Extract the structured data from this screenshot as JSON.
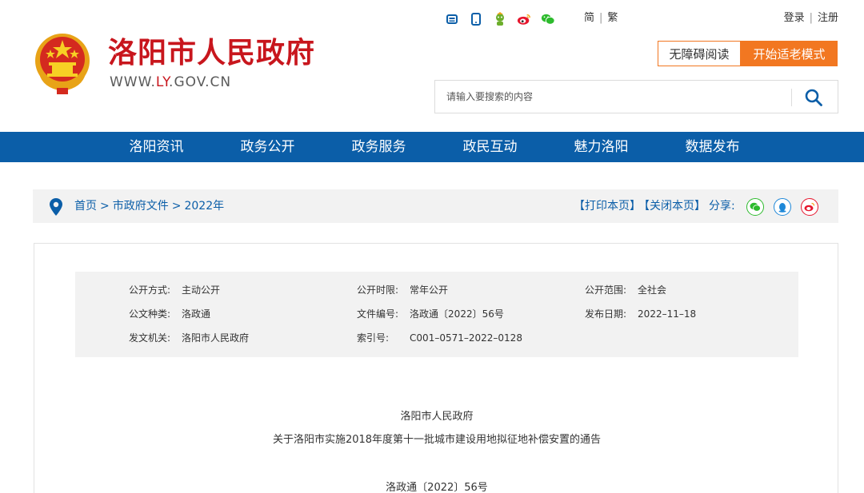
{
  "header": {
    "title": "洛阳市人民政府",
    "url_prefix": "WWW.",
    "url_highlight": "LY",
    "url_suffix": ".GOV.CN",
    "lang_simplified": "简",
    "lang_traditional": "繁",
    "login": "登录",
    "register": "注册",
    "accessible_btn": "无障碍阅读",
    "elder_btn": "开始适老模式",
    "search_placeholder": "请输入要搜索的内容",
    "top_icons": [
      "print-icon",
      "mobile-icon",
      "mascot-icon",
      "weibo-icon",
      "wechat-icon"
    ]
  },
  "nav": {
    "items": [
      "洛阳资讯",
      "政务公开",
      "政务服务",
      "政民互动",
      "魅力洛阳",
      "数据发布"
    ]
  },
  "breadcrumb": {
    "items": [
      "首页",
      "市政府文件",
      "2022年"
    ],
    "separator": ">",
    "print": "【打印本页】",
    "close": "【关闭本页】",
    "share": "分享:",
    "share_icons": [
      "wechat-icon",
      "qq-icon",
      "weibo-icon"
    ]
  },
  "meta": {
    "open_method_label": "公开方式:",
    "open_method": "主动公开",
    "open_period_label": "公开时限:",
    "open_period": "常年公开",
    "open_scope_label": "公开范围:",
    "open_scope": "全社会",
    "doc_type_label": "公文种类:",
    "doc_type": "洛政通",
    "doc_number_label": "文件编号:",
    "doc_number": "洛政通〔2022〕56号",
    "publish_date_label": "发布日期:",
    "publish_date": "2022–11–18",
    "issuer_label": "发文机关:",
    "issuer": "洛阳市人民政府",
    "index_label": "索引号:",
    "index": "C001–0571–2022–0128"
  },
  "document": {
    "org": "洛阳市人民政府",
    "title": "关于洛阳市实施2018年度第十一批城市建设用地拟征地补偿安置的通告",
    "number": "洛政通〔2022〕56号"
  },
  "colors": {
    "brand_red": "#c8161d",
    "nav_blue": "#0b5ea8",
    "accent_orange": "#f27721"
  }
}
